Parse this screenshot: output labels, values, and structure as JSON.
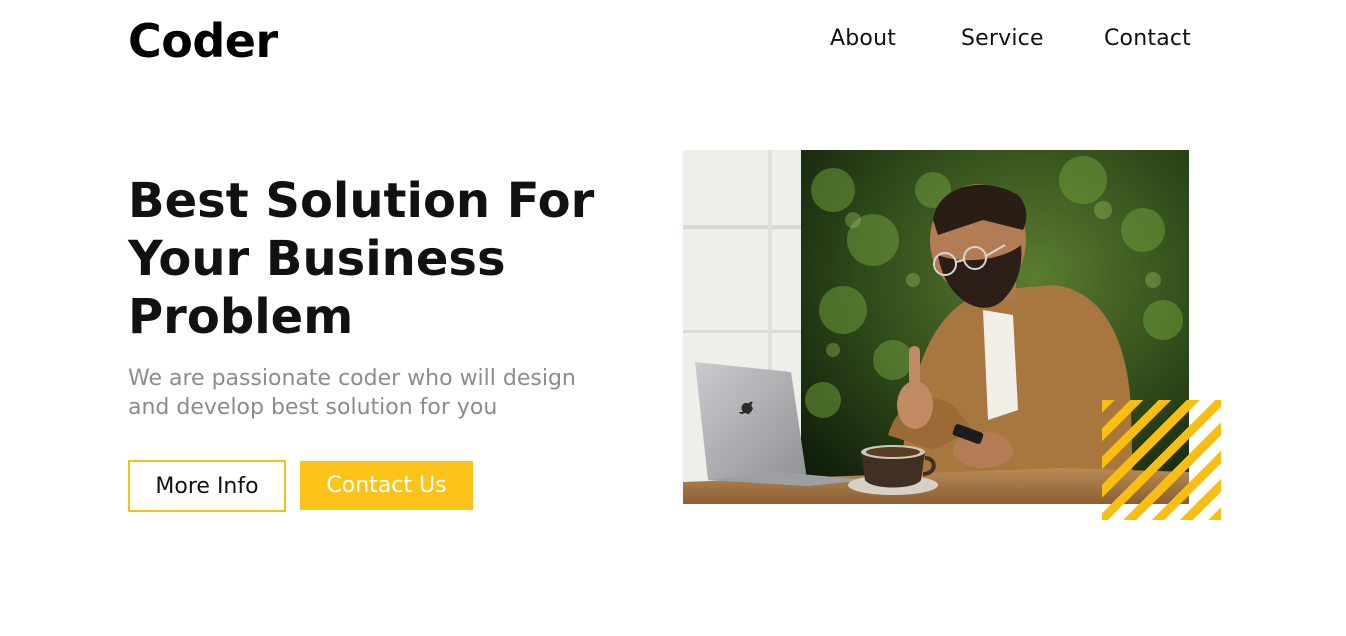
{
  "header": {
    "logo": "Coder",
    "nav": [
      "About",
      "Service",
      "Contact"
    ]
  },
  "hero": {
    "title_lines": [
      "Best Solution For",
      "Your Business",
      "Problem"
    ],
    "subtitle_lines": [
      "We are passionate coder who will design",
      "and develop best solution for you"
    ],
    "buttons": {
      "more_info": "More Info",
      "contact_us": "Contact Us"
    },
    "image_icon": "man-with-laptop-photo"
  },
  "colors": {
    "accent": "#fcc31a",
    "text": "#111111",
    "muted": "#8c8c8c"
  }
}
